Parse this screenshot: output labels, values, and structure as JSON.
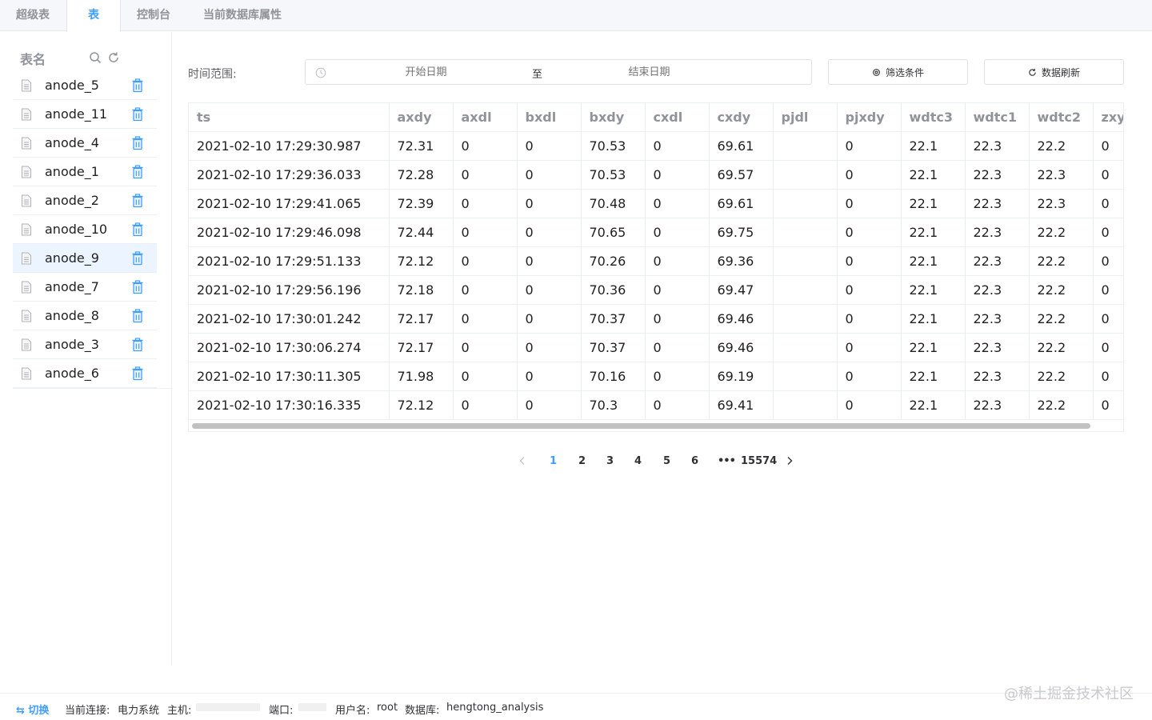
{
  "tabs": [
    "超级表",
    "表",
    "控制台",
    "当前数据库属性"
  ],
  "sidebar": {
    "title": "表名",
    "items": [
      "anode_5",
      "anode_11",
      "anode_4",
      "anode_1",
      "anode_2",
      "anode_10",
      "anode_9",
      "anode_7",
      "anode_8",
      "anode_3",
      "anode_6"
    ],
    "active_index": 6
  },
  "toolbar": {
    "range_label": "时间范围:",
    "start_placeholder": "开始日期",
    "separator": "至",
    "end_placeholder": "结束日期",
    "filter_label": "筛选条件",
    "refresh_label": "数据刷新"
  },
  "table": {
    "columns": [
      "ts",
      "axdy",
      "axdl",
      "bxdl",
      "bxdy",
      "cxdl",
      "cxdy",
      "pjdl",
      "pjxdy",
      "wdtc3",
      "wdtc1",
      "wdtc2",
      "zxyg"
    ],
    "rows": [
      [
        "2021-02-10 17:29:30.987",
        "72.31",
        "0",
        "0",
        "70.53",
        "0",
        "69.61",
        "",
        "0",
        "22.1",
        "22.3",
        "22.2",
        "0"
      ],
      [
        "2021-02-10 17:29:36.033",
        "72.28",
        "0",
        "0",
        "70.53",
        "0",
        "69.57",
        "",
        "0",
        "22.1",
        "22.3",
        "22.3",
        "0"
      ],
      [
        "2021-02-10 17:29:41.065",
        "72.39",
        "0",
        "0",
        "70.48",
        "0",
        "69.61",
        "",
        "0",
        "22.1",
        "22.3",
        "22.3",
        "0"
      ],
      [
        "2021-02-10 17:29:46.098",
        "72.44",
        "0",
        "0",
        "70.65",
        "0",
        "69.75",
        "",
        "0",
        "22.1",
        "22.3",
        "22.2",
        "0"
      ],
      [
        "2021-02-10 17:29:51.133",
        "72.12",
        "0",
        "0",
        "70.26",
        "0",
        "69.36",
        "",
        "0",
        "22.1",
        "22.3",
        "22.2",
        "0"
      ],
      [
        "2021-02-10 17:29:56.196",
        "72.18",
        "0",
        "0",
        "70.36",
        "0",
        "69.47",
        "",
        "0",
        "22.1",
        "22.3",
        "22.2",
        "0"
      ],
      [
        "2021-02-10 17:30:01.242",
        "72.17",
        "0",
        "0",
        "70.37",
        "0",
        "69.46",
        "",
        "0",
        "22.1",
        "22.3",
        "22.2",
        "0"
      ],
      [
        "2021-02-10 17:30:06.274",
        "72.17",
        "0",
        "0",
        "70.37",
        "0",
        "69.46",
        "",
        "0",
        "22.1",
        "22.3",
        "22.2",
        "0"
      ],
      [
        "2021-02-10 17:30:11.305",
        "71.98",
        "0",
        "0",
        "70.16",
        "0",
        "69.19",
        "",
        "0",
        "22.1",
        "22.3",
        "22.2",
        "0"
      ],
      [
        "2021-02-10 17:30:16.335",
        "72.12",
        "0",
        "0",
        "70.3",
        "0",
        "69.41",
        "",
        "0",
        "22.1",
        "22.3",
        "22.2",
        "0"
      ]
    ]
  },
  "pagination": {
    "pages": [
      "1",
      "2",
      "3",
      "4",
      "5",
      "6"
    ],
    "active": "1",
    "ellipsis": "•••",
    "last": "15574"
  },
  "footer": {
    "switch_label": "⇆ 切换",
    "connection_label": "当前连接:",
    "connection_value": "电力系统",
    "host_label": "主机:",
    "port_label": "端口:",
    "user_label": "用户名:",
    "user_value": "root",
    "db_label": "数据库:",
    "db_value": "hengtong_analysis"
  },
  "watermark": "@稀土掘金技术社区",
  "colors": {
    "accent": "#409eff",
    "border": "#ebeef5",
    "active_row": "#ecf5ff"
  }
}
